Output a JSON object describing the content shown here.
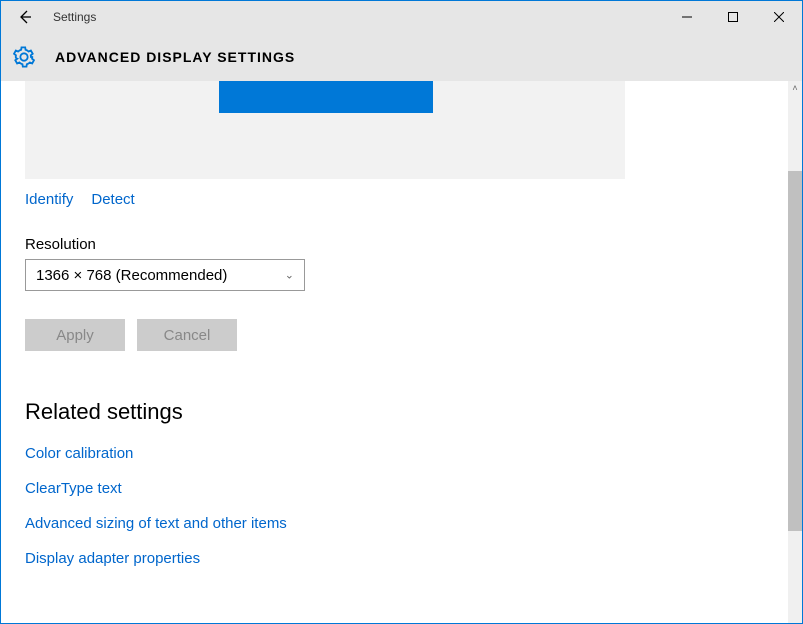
{
  "window": {
    "title": "Settings"
  },
  "header": {
    "title": "ADVANCED DISPLAY SETTINGS"
  },
  "display_actions": {
    "identify": "Identify",
    "detect": "Detect"
  },
  "resolution": {
    "label": "Resolution",
    "selected": "1366 × 768 (Recommended)"
  },
  "buttons": {
    "apply": "Apply",
    "cancel": "Cancel"
  },
  "related": {
    "heading": "Related settings",
    "links": [
      "Color calibration",
      "ClearType text",
      "Advanced sizing of text and other items",
      "Display adapter properties"
    ]
  }
}
